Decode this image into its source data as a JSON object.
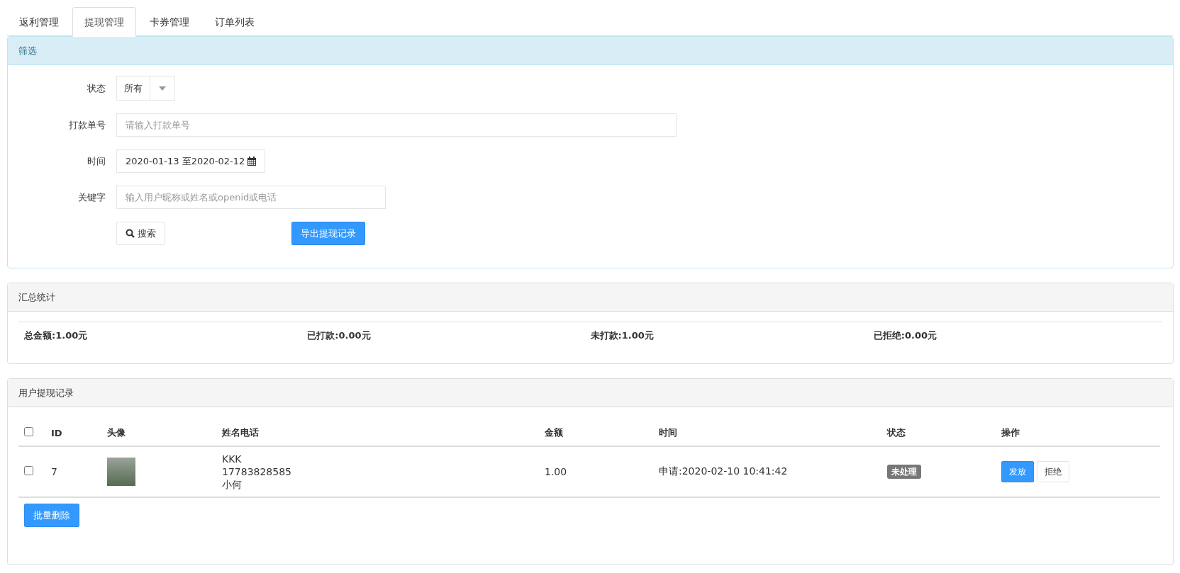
{
  "tabs": [
    {
      "label": "返利管理",
      "selected": false
    },
    {
      "label": "提现管理",
      "selected": true
    },
    {
      "label": "卡券管理",
      "selected": false
    },
    {
      "label": "订单列表",
      "selected": false
    }
  ],
  "filter": {
    "title": "筛选",
    "fields": [
      {
        "kind": "select",
        "label": "状态",
        "value": "所有"
      },
      {
        "kind": "text",
        "label": "打款单号",
        "placeholder": "请输入打款单号"
      },
      {
        "kind": "date",
        "label": "时间",
        "value": "2020-01-13 至2020-02-12"
      },
      {
        "kind": "keyword",
        "label": "关键字",
        "placeholder": "输入用户昵称或姓名或openid或电话"
      }
    ],
    "search_button": "搜索",
    "export_button": "导出提现记录"
  },
  "summary": {
    "title": "汇总统计",
    "items": [
      "总金额:1.00元",
      "已打款:0.00元",
      "未打款:1.00元",
      "已拒绝:0.00元"
    ]
  },
  "records": {
    "title": "用户提现记录",
    "select_all_checked": false,
    "columns": [
      "ID",
      "头像",
      "姓名电话",
      "金额",
      "时间",
      "状态",
      "操作"
    ],
    "rows": [
      {
        "checked": false,
        "id": "7",
        "name_phone": [
          "KKK",
          "17783828585",
          "小何"
        ],
        "amount": "1.00",
        "time": "申请:2020-02-10 10:41:42",
        "status": "未处理",
        "actions": [
          {
            "label": "发放",
            "kind": "primary"
          },
          {
            "label": "拒绝",
            "kind": "default"
          }
        ]
      }
    ],
    "bulk_delete": "批量删除"
  }
}
